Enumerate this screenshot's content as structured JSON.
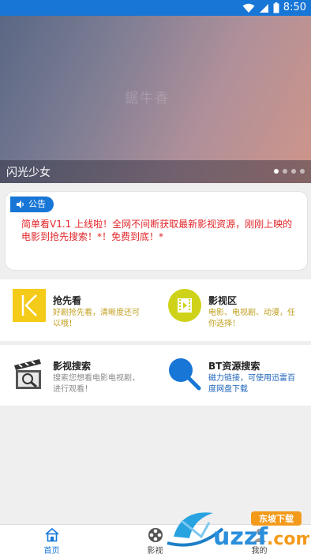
{
  "status_bar": {
    "time": "8:50",
    "wifi_icon": "wifi-icon",
    "signal_icon": "signal-icon",
    "battery_icon": "battery-icon"
  },
  "banner": {
    "watermark": "鋸牛香",
    "caption": "闪光少女",
    "dots": 4,
    "active_dot": 1
  },
  "notice": {
    "tag_icon": "speaker-icon",
    "tag_label": "公告",
    "text": "简单看V1.1 上线啦！全网不间断获取最新影视资源，刚刚上映的电影到抢先搜索！*！免费到底！*"
  },
  "menu": {
    "row1": [
      {
        "icon": "k-logo-icon",
        "title": "抢先看",
        "desc": "好剧抢先看，清晰度还可以哦！",
        "desc_color": "#c0a020"
      },
      {
        "icon": "film-icon",
        "title": "影视区",
        "desc": "电影、电视剧、动漫，任你选择！",
        "desc_color": "#c0a020"
      }
    ],
    "row2": [
      {
        "icon": "clapperboard-search-icon",
        "title": "影视搜索",
        "desc": "搜索您想看电影电视剧，进行观看！",
        "desc_color": "#8a8a8a"
      },
      {
        "icon": "magnifier-icon",
        "title": "BT资源搜索",
        "desc": "磁力链接，可使用迅雷百度网盘下载",
        "desc_color": "#1b63b8"
      }
    ]
  },
  "nav": [
    {
      "icon": "home-icon",
      "label": "首页",
      "active": true
    },
    {
      "icon": "film-reel-icon",
      "label": "影视",
      "active": false
    },
    {
      "icon": "user-icon",
      "label": "我的",
      "active": false
    }
  ],
  "watermark_logo": {
    "text": "uzzf",
    "suffix": ".com",
    "badge": "东坡下载"
  },
  "colors": {
    "primary": "#1776d6",
    "notice_text": "#e0262a"
  }
}
